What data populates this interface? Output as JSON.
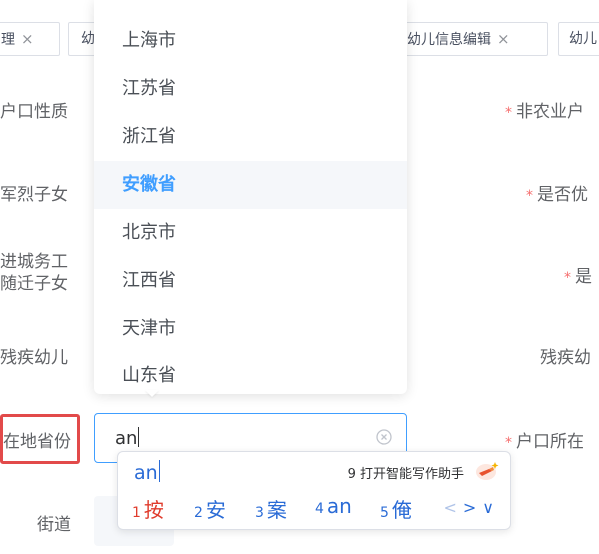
{
  "tabs": [
    {
      "label": "理",
      "close": "×"
    },
    {
      "label": "幼",
      "close": ""
    },
    {
      "label": "幼儿信息编辑",
      "close": "×"
    },
    {
      "label": "幼儿",
      "close": ""
    }
  ],
  "form": {
    "left_labels": {
      "hukou_nature": "户口性质",
      "martyr_child": "军烈子女",
      "migrant_line1": "进城务工",
      "migrant_line2": "随迁子女",
      "disabled_child": "残疾幼儿",
      "province": "在地省份",
      "street": "街道"
    },
    "right_labels": {
      "non_agri": "非农业户",
      "is_preferential": "是否优",
      "is_short": "是",
      "disabled_right": "残疾幼",
      "hukou_location": "户口所在"
    },
    "required_mark": "*"
  },
  "province_input": {
    "value": "an"
  },
  "dropdown": {
    "options": [
      "上海市",
      "江苏省",
      "浙江省",
      "安徽省",
      "北京市",
      "江西省",
      "天津市",
      "山东省"
    ],
    "selected": "安徽省"
  },
  "ime": {
    "composition": "an",
    "assist_text": "9 打开智能写作助手",
    "candidates": [
      {
        "num": "1",
        "text": "按"
      },
      {
        "num": "2",
        "text": "安"
      },
      {
        "num": "3",
        "text": "案"
      },
      {
        "num": "4",
        "text": "an"
      },
      {
        "num": "5",
        "text": "俺"
      }
    ],
    "nav": {
      "prev": "<",
      "next": ">",
      "expand": "∨"
    }
  },
  "colors": {
    "accent": "#409eff",
    "required": "#f56c6c",
    "highlight_box": "#e24a4a",
    "ime_blue": "#2a6bd6",
    "ime_first": "#e03c2d"
  },
  "icons": [
    "close-icon",
    "clear-icon",
    "ai-assistant-icon",
    "chevron-left-icon",
    "chevron-right-icon",
    "chevron-down-icon"
  ]
}
